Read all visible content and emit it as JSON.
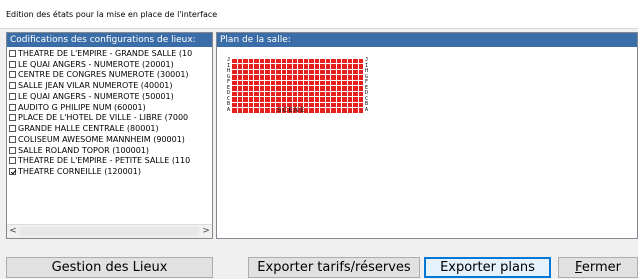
{
  "window": {
    "title": "Edition des états pour la mise en place de l'interface"
  },
  "left_panel": {
    "header": "Codifications des configurations de lieux:",
    "items": [
      {
        "label": "THEATRE DE L'EMPIRE - GRANDE SALLE (10",
        "checked": false
      },
      {
        "label": "LE QUAI ANGERS - NUMEROTE (20001)",
        "checked": false
      },
      {
        "label": "CENTRE DE CONGRES NUMEROTE (30001)",
        "checked": false
      },
      {
        "label": "SALLE JEAN VILAR NUMEROTE (40001)",
        "checked": false
      },
      {
        "label": "LE QUAI ANGERS - NUMEROTE (50001)",
        "checked": false
      },
      {
        "label": "AUDITO G PHILIPE NUM (60001)",
        "checked": false
      },
      {
        "label": "PLACE DE L'HOTEL DE VILLE - LIBRE (7000",
        "checked": false
      },
      {
        "label": "GRANDE HALLE CENTRALE (80001)",
        "checked": false
      },
      {
        "label": "COLISEUM AWESOME MANNHEIM (90001)",
        "checked": false
      },
      {
        "label": "SALLE ROLAND TOPOR (100001)",
        "checked": false
      },
      {
        "label": "THEATRE DE L'EMPIRE - PETITE SALLE (110",
        "checked": false
      },
      {
        "label": "THEATRE CORNEILLE (120001)",
        "checked": true
      }
    ],
    "scroll_left": "<",
    "scroll_right": ">"
  },
  "right_panel": {
    "header": "Plan de la salle:",
    "rows": [
      "J",
      "I",
      "H",
      "G",
      "F",
      "E",
      "D",
      "C",
      "B",
      "A"
    ],
    "seats_per_row": 24,
    "seat_color": "#e5201d",
    "stage_label": "SCENE"
  },
  "buttons": {
    "gestion": "Gestion des Lieux",
    "tarifs": "Exporter tarifs/réserves",
    "plans": "Exporter plans",
    "fermer_first": "F",
    "fermer_rest": "ermer"
  }
}
